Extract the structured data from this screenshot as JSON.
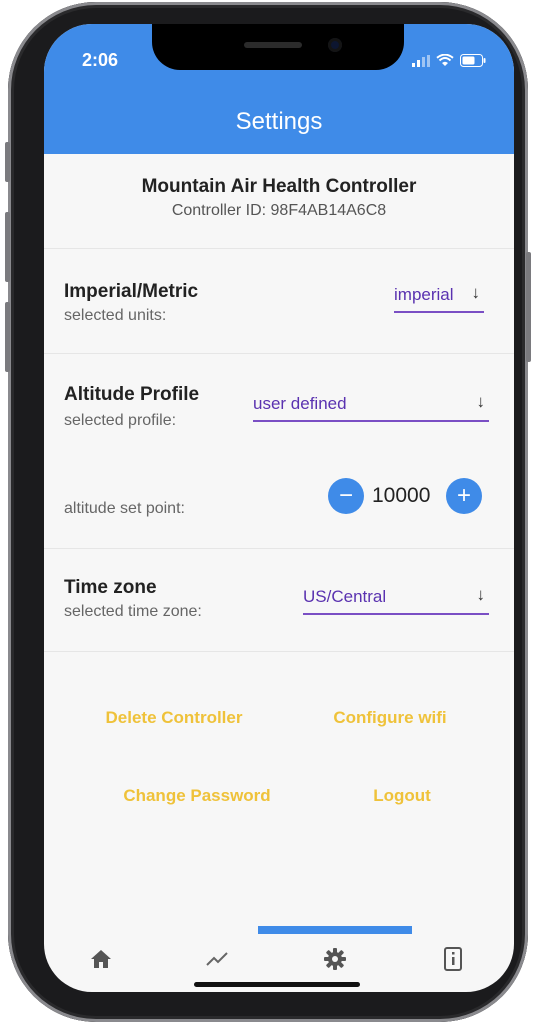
{
  "status_bar": {
    "time": "2:06"
  },
  "appbar": {
    "title": "Settings",
    "color": "#3f8be8"
  },
  "controller": {
    "name": "Mountain Air Health Controller",
    "id_text": "Controller ID: 98F4AB14A6C8"
  },
  "units": {
    "title": "Imperial/Metric",
    "subtitle": "selected units:",
    "selected": "imperial",
    "arrow": "↓"
  },
  "altitude": {
    "title": "Altitude Profile",
    "subtitle": "selected profile:",
    "selected": "user defined",
    "arrow": "↓",
    "set_point_label": "altitude set point:",
    "set_point_value": "10000",
    "decrement": "−",
    "increment": "+"
  },
  "timezone": {
    "title": "Time zone",
    "subtitle": "selected time zone:",
    "selected": "US/Central",
    "arrow": "↓"
  },
  "actions": {
    "delete_controller": "Delete Controller",
    "configure_wifi": "Configure wifi",
    "change_password": "Change Password",
    "logout": "Logout",
    "color": "#efc23a"
  },
  "bottom_nav": {
    "items": [
      {
        "icon": "home-icon"
      },
      {
        "icon": "trend-chart-icon"
      },
      {
        "icon": "gear-icon",
        "selected": true
      },
      {
        "icon": "info-icon"
      }
    ]
  }
}
